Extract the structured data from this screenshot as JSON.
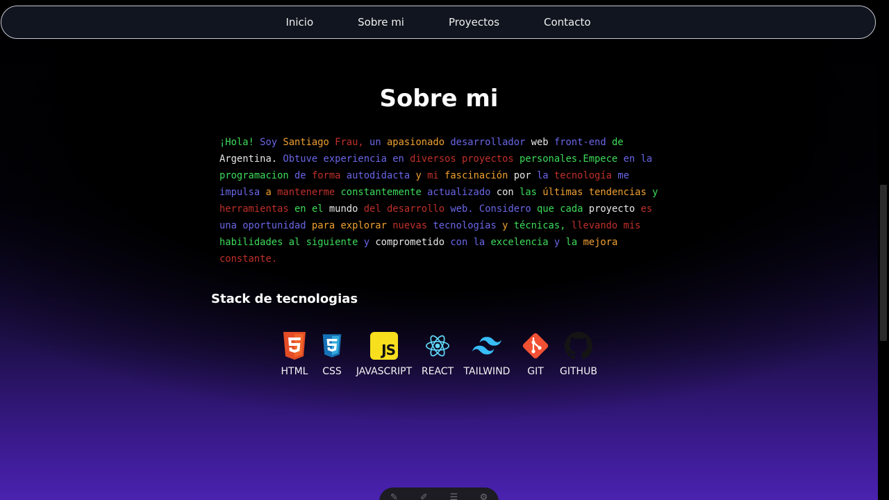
{
  "nav": {
    "items": [
      "Inicio",
      "Sobre mi",
      "Proyectos",
      "Contacto"
    ]
  },
  "about": {
    "title": "Sobre mi",
    "bio_words": [
      {
        "t": "¡Hola!",
        "c": "#3ddc5a"
      },
      {
        "t": "Soy",
        "c": "#6a66e8"
      },
      {
        "t": "Santiago",
        "c": "#f0a030"
      },
      {
        "t": "Frau,",
        "c": "#c0302a"
      },
      {
        "t": "un",
        "c": "#6a66e8"
      },
      {
        "t": "apasionado",
        "c": "#f0a030"
      },
      {
        "t": "desarrollador",
        "c": "#6a66e8"
      },
      {
        "t": "web",
        "c": "#e8e8e8"
      },
      {
        "t": "front-end",
        "c": "#6a66e8"
      },
      {
        "t": "de",
        "c": "#3ddc5a"
      },
      {
        "t": "Argentina.",
        "c": "#e8e8e8"
      },
      {
        "t": "Obtuve",
        "c": "#6a66e8"
      },
      {
        "t": "experiencia",
        "c": "#6a66e8"
      },
      {
        "t": "en",
        "c": "#6a66e8"
      },
      {
        "t": "diversos",
        "c": "#c0302a"
      },
      {
        "t": "proyectos",
        "c": "#c0302a"
      },
      {
        "t": "personales.Empece",
        "c": "#3ddc5a"
      },
      {
        "t": "en",
        "c": "#6a66e8"
      },
      {
        "t": "la",
        "c": "#6a66e8"
      },
      {
        "t": "programacion",
        "c": "#3ddc5a"
      },
      {
        "t": "de",
        "c": "#6a66e8"
      },
      {
        "t": "forma",
        "c": "#c0302a"
      },
      {
        "t": "autodidacta",
        "c": "#6a66e8"
      },
      {
        "t": "y",
        "c": "#f0a030"
      },
      {
        "t": "mi",
        "c": "#c0302a"
      },
      {
        "t": "fascinación",
        "c": "#f0a030"
      },
      {
        "t": "por",
        "c": "#e8e8e8"
      },
      {
        "t": "la",
        "c": "#6a66e8"
      },
      {
        "t": "tecnología",
        "c": "#c0302a"
      },
      {
        "t": "me",
        "c": "#6a66e8"
      },
      {
        "t": "impulsa",
        "c": "#6a66e8"
      },
      {
        "t": "a",
        "c": "#f0a030"
      },
      {
        "t": "mantenerme",
        "c": "#c0302a"
      },
      {
        "t": "constantemente",
        "c": "#3ddc5a"
      },
      {
        "t": "actualizado",
        "c": "#6a66e8"
      },
      {
        "t": "con",
        "c": "#e8e8e8"
      },
      {
        "t": "las",
        "c": "#3ddc5a"
      },
      {
        "t": "últimas",
        "c": "#f0a030"
      },
      {
        "t": "tendencias",
        "c": "#f0a030"
      },
      {
        "t": "y",
        "c": "#3ddc5a"
      },
      {
        "t": "herramientas",
        "c": "#c0302a"
      },
      {
        "t": "en",
        "c": "#3ddc5a"
      },
      {
        "t": "el",
        "c": "#3ddc5a"
      },
      {
        "t": "mundo",
        "c": "#e8e8e8"
      },
      {
        "t": "del",
        "c": "#c0302a"
      },
      {
        "t": "desarrollo",
        "c": "#c0302a"
      },
      {
        "t": "web.",
        "c": "#6a66e8"
      },
      {
        "t": "Considero",
        "c": "#6a66e8"
      },
      {
        "t": "que",
        "c": "#3ddc5a"
      },
      {
        "t": "cada",
        "c": "#3ddc5a"
      },
      {
        "t": "proyecto",
        "c": "#e8e8e8"
      },
      {
        "t": "es",
        "c": "#c0302a"
      },
      {
        "t": "una",
        "c": "#6a66e8"
      },
      {
        "t": "oportunidad",
        "c": "#6a66e8"
      },
      {
        "t": "para",
        "c": "#f0a030"
      },
      {
        "t": "explorar",
        "c": "#f0a030"
      },
      {
        "t": "nuevas",
        "c": "#c0302a"
      },
      {
        "t": "tecnologías",
        "c": "#6a66e8"
      },
      {
        "t": "y",
        "c": "#f0a030"
      },
      {
        "t": "técnicas,",
        "c": "#3ddc5a"
      },
      {
        "t": "llevando",
        "c": "#c0302a"
      },
      {
        "t": "mis",
        "c": "#c0302a"
      },
      {
        "t": "habilidades",
        "c": "#3ddc5a"
      },
      {
        "t": "al",
        "c": "#3ddc5a"
      },
      {
        "t": "siguiente",
        "c": "#3ddc5a"
      },
      {
        "t": "y",
        "c": "#6a66e8"
      },
      {
        "t": "comprometido",
        "c": "#e8e8e8"
      },
      {
        "t": "con",
        "c": "#6a66e8"
      },
      {
        "t": "la",
        "c": "#6a66e8"
      },
      {
        "t": "excelencia",
        "c": "#3ddc5a"
      },
      {
        "t": "y",
        "c": "#6a66e8"
      },
      {
        "t": "la",
        "c": "#3ddc5a"
      },
      {
        "t": "mejora",
        "c": "#f0a030"
      },
      {
        "t": "constante.",
        "c": "#c0302a"
      }
    ]
  },
  "stack": {
    "title": "Stack de tecnologias",
    "items": [
      {
        "label": "HTML",
        "icon": "html5-icon"
      },
      {
        "label": "CSS",
        "icon": "css3-icon"
      },
      {
        "label": "JAVASCRIPT",
        "icon": "javascript-icon"
      },
      {
        "label": "REACT",
        "icon": "react-icon"
      },
      {
        "label": "TAILWIND",
        "icon": "tailwind-icon"
      },
      {
        "label": "GIT",
        "icon": "git-icon"
      },
      {
        "label": "GITHUB",
        "icon": "github-icon"
      }
    ]
  },
  "colors": {
    "green": "#3ddc5a",
    "blue": "#6a66e8",
    "orange": "#f0a030",
    "red": "#c0302a",
    "white": "#e8e8e8",
    "nav_bg": "#10151f",
    "gradient_bottom": "#4a22b0"
  }
}
